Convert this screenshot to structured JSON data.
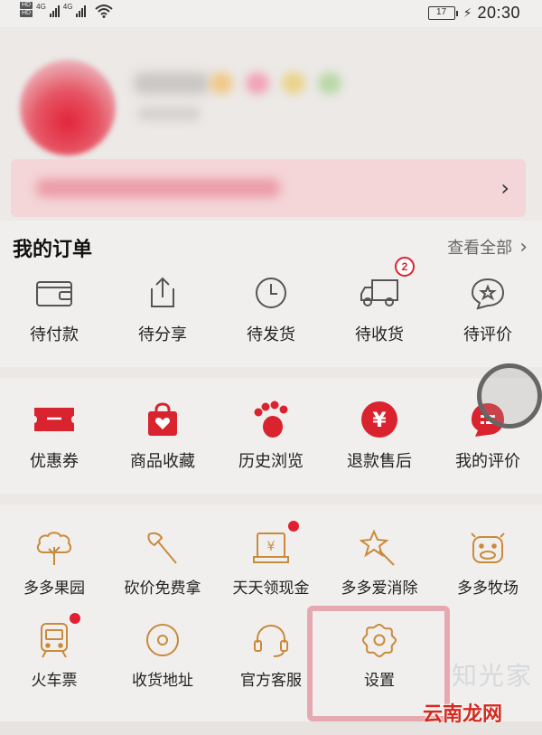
{
  "status_bar": {
    "sim1": "HD",
    "sim2": "HD",
    "net1": "4G",
    "net2": "4G",
    "battery": "17",
    "time": "20:30"
  },
  "orders": {
    "title": "我的订单",
    "view_all": "查看全部",
    "items": [
      {
        "label": "待付款",
        "icon": "wallet-icon"
      },
      {
        "label": "待分享",
        "icon": "share-icon"
      },
      {
        "label": "待发货",
        "icon": "clock-icon"
      },
      {
        "label": "待收货",
        "icon": "truck-icon",
        "badge": "2"
      },
      {
        "label": "待评价",
        "icon": "review-icon"
      }
    ]
  },
  "tools": {
    "items": [
      {
        "label": "优惠券",
        "icon": "coupon-icon"
      },
      {
        "label": "商品收藏",
        "icon": "favorite-bag-icon"
      },
      {
        "label": "历史浏览",
        "icon": "footprint-icon"
      },
      {
        "label": "退款售后",
        "icon": "refund-icon"
      },
      {
        "label": "我的评价",
        "icon": "comment-icon"
      }
    ]
  },
  "games": {
    "row1": [
      {
        "label": "多多果园",
        "icon": "tree-icon"
      },
      {
        "label": "砍价免费拿",
        "icon": "axe-icon"
      },
      {
        "label": "天天领现金",
        "icon": "cash-icon",
        "dot": true
      },
      {
        "label": "多多爱消除",
        "icon": "star-wand-icon"
      },
      {
        "label": "多多牧场",
        "icon": "cow-icon"
      }
    ],
    "row2": [
      {
        "label": "火车票",
        "icon": "train-icon",
        "dot": true
      },
      {
        "label": "收货地址",
        "icon": "location-icon"
      },
      {
        "label": "官方客服",
        "icon": "headset-icon"
      },
      {
        "label": "设置",
        "icon": "settings-gear-icon"
      }
    ]
  },
  "watermark": {
    "text": "云南龙网",
    "ghost": "知光家"
  },
  "colors": {
    "accent_red": "#d9232e",
    "icon_orange": "#c98a3c",
    "highlight": "#e7a9b1"
  }
}
